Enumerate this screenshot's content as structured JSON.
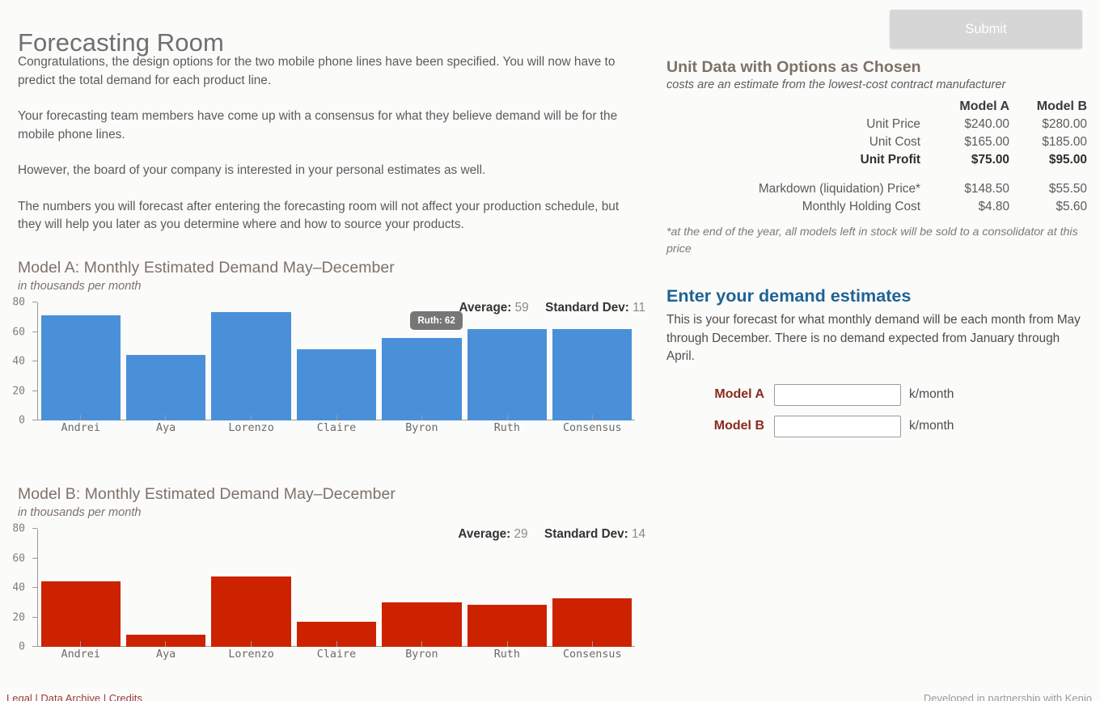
{
  "header": {
    "title": "Forecasting Room",
    "submit_label": "Submit"
  },
  "intro": {
    "p1": "Congratulations, the design options for the two mobile phone lines have been specified. You will now have to predict the total demand for each product line.",
    "p2": "Your forecasting team members have come up with a consensus for what they believe demand will be for the mobile phone lines.",
    "p3": "However, the board of your company is interested in your personal estimates as well.",
    "p4": "The numbers you will forecast after entering the forecasting room will not affect your production schedule, but they will help you later as you determine where and how to source your products."
  },
  "unit_data": {
    "title": "Unit Data with Options as Chosen",
    "subtitle": "costs are an estimate from the lowest-cost contract manufacturer",
    "col_a": "Model A",
    "col_b": "Model B",
    "rows": [
      {
        "label": "Unit Price",
        "a": "$240.00",
        "b": "$280.00"
      },
      {
        "label": "Unit Cost",
        "a": "$165.00",
        "b": "$185.00"
      },
      {
        "label": "Unit Profit",
        "a": "$75.00",
        "b": "$95.00"
      }
    ],
    "rows2": [
      {
        "label": "Markdown (liquidation) Price*",
        "a": "$148.50",
        "b": "$55.50"
      },
      {
        "label": "Monthly Holding Cost",
        "a": "$4.80",
        "b": "$5.60"
      }
    ],
    "footnote": "*at the end of the year, all models left in stock will be sold to a consolidator at this price"
  },
  "estimates": {
    "title": "Enter your demand estimates",
    "description": "This is your forecast for what monthly demand will be each month from May through December. There is no demand expected from January through April.",
    "model_a_label": "Model A",
    "model_b_label": "Model B",
    "model_a_value": "",
    "model_b_value": "",
    "unit_suffix": "k/month"
  },
  "footer": {
    "left": "Legal | Data Archive | Credits",
    "right": "Developed in partnership with Kenio"
  },
  "chart_data": [
    {
      "type": "bar",
      "title": "Model A: Monthly Estimated Demand May–December",
      "subtitle": "in thousands per month",
      "categories": [
        "Andrei",
        "Aya",
        "Lorenzo",
        "Claire",
        "Byron",
        "Ruth",
        "Consensus"
      ],
      "values": [
        71,
        44.5,
        73.5,
        48,
        56,
        62,
        62
      ],
      "ylim": [
        0,
        80
      ],
      "yticks": [
        0,
        20,
        40,
        60,
        80
      ],
      "xlabel": "",
      "ylabel": "",
      "grid": false,
      "legend": "none",
      "color": "#4a90d9",
      "stats": {
        "average_label": "Average:",
        "average": "59",
        "stdev_label": "Standard Dev:",
        "stdev": "11"
      },
      "tooltip": {
        "text": "Ruth: 62",
        "category": "Ruth"
      }
    },
    {
      "type": "bar",
      "title": "Model B: Monthly Estimated Demand May–December",
      "subtitle": "in thousands per month",
      "categories": [
        "Andrei",
        "Aya",
        "Lorenzo",
        "Claire",
        "Byron",
        "Ruth",
        "Consensus"
      ],
      "values": [
        44.5,
        8.5,
        47.5,
        17,
        30,
        28.5,
        33
      ],
      "ylim": [
        0,
        80
      ],
      "yticks": [
        0,
        20,
        40,
        60,
        80
      ],
      "xlabel": "",
      "ylabel": "",
      "grid": false,
      "legend": "none",
      "color": "#cc2200",
      "stats": {
        "average_label": "Average:",
        "average": "29",
        "stdev_label": "Standard Dev:",
        "stdev": "14"
      },
      "tooltip": null
    }
  ]
}
